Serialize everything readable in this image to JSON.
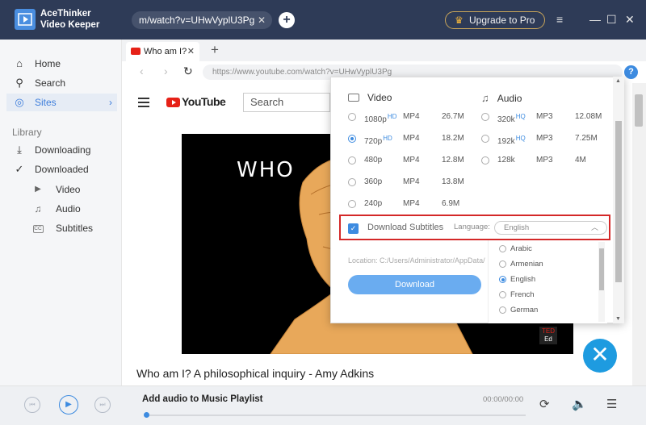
{
  "app": {
    "name_line1": "AceThinker",
    "name_line2": "Video Keeper",
    "url_pill": "m/watch?v=UHwVyplU3Pg",
    "upgrade_label": "Upgrade to Pro"
  },
  "sidebar": {
    "home": "Home",
    "search": "Search",
    "sites": "Sites",
    "library_label": "Library",
    "downloading": "Downloading",
    "downloaded": "Downloaded",
    "video": "Video",
    "audio": "Audio",
    "subtitles": "Subtitles"
  },
  "browser": {
    "tab_title": "Who am I?",
    "address": "https://www.youtube.com/watch?v=UHwVyplU3Pg",
    "yt_logo": "YouTube",
    "search_placeholder": "Search",
    "video_text": "WHO",
    "video_title": "Who am I? A philosophical inquiry - Amy Adkins",
    "ted_badge_top": "TED",
    "ted_badge_bottom": "Ed"
  },
  "popup": {
    "video_header": "Video",
    "audio_header": "Audio",
    "video_rows": [
      {
        "quality": "1080p",
        "badge": "HD",
        "format": "MP4",
        "size": "26.7M",
        "selected": false
      },
      {
        "quality": "720p",
        "badge": "HD",
        "format": "MP4",
        "size": "18.2M",
        "selected": true
      },
      {
        "quality": "480p",
        "badge": "",
        "format": "MP4",
        "size": "12.8M",
        "selected": false
      },
      {
        "quality": "360p",
        "badge": "",
        "format": "MP4",
        "size": "13.8M",
        "selected": false
      },
      {
        "quality": "240p",
        "badge": "",
        "format": "MP4",
        "size": "6.9M",
        "selected": false
      }
    ],
    "audio_rows": [
      {
        "quality": "320k",
        "badge": "HQ",
        "format": "MP3",
        "size": "12.08M",
        "selected": false
      },
      {
        "quality": "192k",
        "badge": "HQ",
        "format": "MP3",
        "size": "7.25M",
        "selected": false
      },
      {
        "quality": "128k",
        "badge": "",
        "format": "MP3",
        "size": "4M",
        "selected": false
      }
    ],
    "subtitles_label": "Download Subtitles",
    "subtitles_checked": true,
    "language_label": "Language:",
    "language_value": "English",
    "location": "Location: C:/Users/Administrator/AppData/",
    "download_label": "Download",
    "languages": [
      {
        "name": "Arabic",
        "selected": false
      },
      {
        "name": "Armenian",
        "selected": false
      },
      {
        "name": "English",
        "selected": true
      },
      {
        "name": "French",
        "selected": false
      },
      {
        "name": "German",
        "selected": false
      }
    ]
  },
  "player": {
    "track": "Add audio to Music Playlist",
    "time": "00:00/00:00"
  },
  "colors": {
    "titlebar": "#2e3b57",
    "accent": "#3d8be0",
    "highlight_border": "#d42828"
  }
}
